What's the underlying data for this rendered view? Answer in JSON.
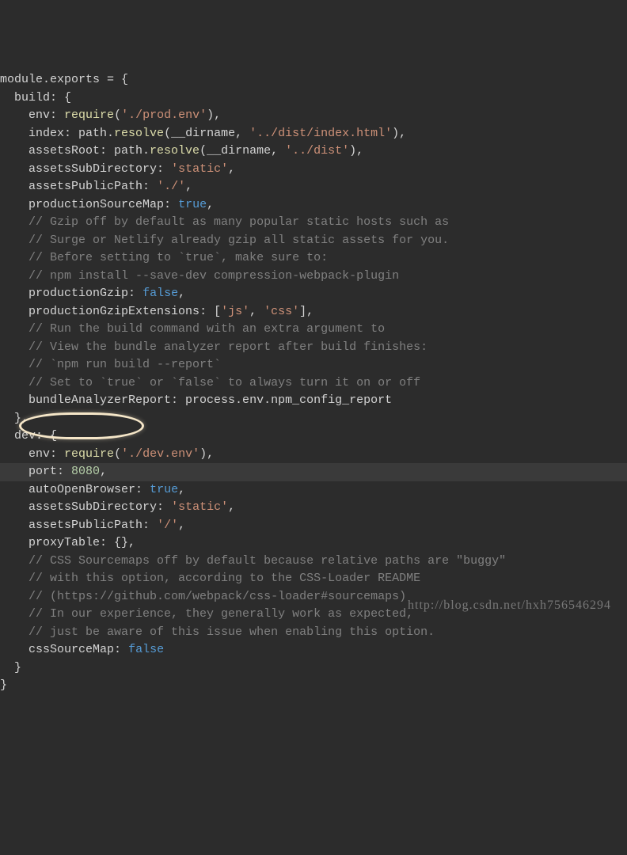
{
  "lines": [
    {
      "indent": 0,
      "seg": [
        {
          "cls": "ident",
          "t": "module"
        },
        {
          "cls": "punct",
          "t": "."
        },
        {
          "cls": "ident",
          "t": "exports"
        },
        {
          "cls": "punct",
          "t": " = {"
        }
      ]
    },
    {
      "indent": 1,
      "seg": [
        {
          "cls": "prop",
          "t": "build"
        },
        {
          "cls": "punct",
          "t": ": {"
        }
      ]
    },
    {
      "indent": 2,
      "seg": [
        {
          "cls": "prop",
          "t": "env"
        },
        {
          "cls": "punct",
          "t": ": "
        },
        {
          "cls": "fn",
          "t": "require"
        },
        {
          "cls": "punct",
          "t": "("
        },
        {
          "cls": "str",
          "t": "'./prod.env'"
        },
        {
          "cls": "punct",
          "t": "),"
        }
      ]
    },
    {
      "indent": 2,
      "seg": [
        {
          "cls": "prop",
          "t": "index"
        },
        {
          "cls": "punct",
          "t": ": path."
        },
        {
          "cls": "fn",
          "t": "resolve"
        },
        {
          "cls": "punct",
          "t": "(__dirname, "
        },
        {
          "cls": "str",
          "t": "'../dist/index.html'"
        },
        {
          "cls": "punct",
          "t": "),"
        }
      ]
    },
    {
      "indent": 2,
      "seg": [
        {
          "cls": "prop",
          "t": "assetsRoot"
        },
        {
          "cls": "punct",
          "t": ": path."
        },
        {
          "cls": "fn",
          "t": "resolve"
        },
        {
          "cls": "punct",
          "t": "(__dirname, "
        },
        {
          "cls": "str",
          "t": "'../dist'"
        },
        {
          "cls": "punct",
          "t": "),"
        }
      ]
    },
    {
      "indent": 2,
      "seg": [
        {
          "cls": "prop",
          "t": "assetsSubDirectory"
        },
        {
          "cls": "punct",
          "t": ": "
        },
        {
          "cls": "str",
          "t": "'static'"
        },
        {
          "cls": "punct",
          "t": ","
        }
      ]
    },
    {
      "indent": 2,
      "seg": [
        {
          "cls": "prop",
          "t": "assetsPublicPath"
        },
        {
          "cls": "punct",
          "t": ": "
        },
        {
          "cls": "str",
          "t": "'./'"
        },
        {
          "cls": "punct",
          "t": ","
        }
      ]
    },
    {
      "indent": 2,
      "seg": [
        {
          "cls": "prop",
          "t": "productionSourceMap"
        },
        {
          "cls": "punct",
          "t": ": "
        },
        {
          "cls": "bool",
          "t": "true"
        },
        {
          "cls": "punct",
          "t": ","
        }
      ]
    },
    {
      "indent": 2,
      "seg": [
        {
          "cls": "comment",
          "t": "// Gzip off by default as many popular static hosts such as"
        }
      ]
    },
    {
      "indent": 2,
      "seg": [
        {
          "cls": "comment",
          "t": "// Surge or Netlify already gzip all static assets for you."
        }
      ]
    },
    {
      "indent": 2,
      "seg": [
        {
          "cls": "comment",
          "t": "// Before setting to `true`, make sure to:"
        }
      ]
    },
    {
      "indent": 2,
      "seg": [
        {
          "cls": "comment",
          "t": "// npm install --save-dev compression-webpack-plugin"
        }
      ]
    },
    {
      "indent": 2,
      "seg": [
        {
          "cls": "prop",
          "t": "productionGzip"
        },
        {
          "cls": "punct",
          "t": ": "
        },
        {
          "cls": "bool",
          "t": "false"
        },
        {
          "cls": "punct",
          "t": ","
        }
      ]
    },
    {
      "indent": 2,
      "seg": [
        {
          "cls": "prop",
          "t": "productionGzipExtensions"
        },
        {
          "cls": "punct",
          "t": ": ["
        },
        {
          "cls": "str",
          "t": "'js'"
        },
        {
          "cls": "punct",
          "t": ", "
        },
        {
          "cls": "str",
          "t": "'css'"
        },
        {
          "cls": "punct",
          "t": "],"
        }
      ]
    },
    {
      "indent": 2,
      "seg": [
        {
          "cls": "comment",
          "t": "// Run the build command with an extra argument to"
        }
      ]
    },
    {
      "indent": 2,
      "seg": [
        {
          "cls": "comment",
          "t": "// View the bundle analyzer report after build finishes:"
        }
      ]
    },
    {
      "indent": 2,
      "seg": [
        {
          "cls": "comment",
          "t": "// `npm run build --report`"
        }
      ]
    },
    {
      "indent": 2,
      "seg": [
        {
          "cls": "comment",
          "t": "// Set to `true` or `false` to always turn it on or off"
        }
      ]
    },
    {
      "indent": 2,
      "seg": [
        {
          "cls": "prop",
          "t": "bundleAnalyzerReport"
        },
        {
          "cls": "punct",
          "t": ": process.env.npm_config_report"
        }
      ]
    },
    {
      "indent": 1,
      "seg": [
        {
          "cls": "punct",
          "t": "},"
        }
      ]
    },
    {
      "indent": 1,
      "seg": [
        {
          "cls": "prop",
          "t": "dev"
        },
        {
          "cls": "punct",
          "t": ": {"
        }
      ]
    },
    {
      "indent": 2,
      "seg": [
        {
          "cls": "prop",
          "t": "env"
        },
        {
          "cls": "punct",
          "t": ": "
        },
        {
          "cls": "fn",
          "t": "require"
        },
        {
          "cls": "punct",
          "t": "("
        },
        {
          "cls": "str",
          "t": "'./dev.env'"
        },
        {
          "cls": "punct",
          "t": "),"
        }
      ]
    },
    {
      "indent": 2,
      "highlight": true,
      "seg": [
        {
          "cls": "prop",
          "t": "port"
        },
        {
          "cls": "punct",
          "t": ": "
        },
        {
          "cls": "num",
          "t": "8080"
        },
        {
          "cls": "punct",
          "t": ","
        }
      ]
    },
    {
      "indent": 2,
      "seg": [
        {
          "cls": "prop",
          "t": "autoOpenBrowser"
        },
        {
          "cls": "punct",
          "t": ": "
        },
        {
          "cls": "bool",
          "t": "true"
        },
        {
          "cls": "punct",
          "t": ","
        }
      ]
    },
    {
      "indent": 2,
      "seg": [
        {
          "cls": "prop",
          "t": "assetsSubDirectory"
        },
        {
          "cls": "punct",
          "t": ": "
        },
        {
          "cls": "str",
          "t": "'static'"
        },
        {
          "cls": "punct",
          "t": ","
        }
      ]
    },
    {
      "indent": 2,
      "seg": [
        {
          "cls": "prop",
          "t": "assetsPublicPath"
        },
        {
          "cls": "punct",
          "t": ": "
        },
        {
          "cls": "str",
          "t": "'/'"
        },
        {
          "cls": "punct",
          "t": ","
        }
      ]
    },
    {
      "indent": 2,
      "seg": [
        {
          "cls": "prop",
          "t": "proxyTable"
        },
        {
          "cls": "punct",
          "t": ": {},"
        }
      ]
    },
    {
      "indent": 2,
      "seg": [
        {
          "cls": "comment",
          "t": "// CSS Sourcemaps off by default because relative paths are \"buggy\""
        }
      ]
    },
    {
      "indent": 2,
      "seg": [
        {
          "cls": "comment",
          "t": "// with this option, according to the CSS-Loader README"
        }
      ]
    },
    {
      "indent": 2,
      "seg": [
        {
          "cls": "comment",
          "t": "// (https://github.com/webpack/css-loader#sourcemaps)"
        }
      ]
    },
    {
      "indent": 2,
      "seg": [
        {
          "cls": "comment",
          "t": "// In our experience, they generally work as expected,"
        }
      ]
    },
    {
      "indent": 2,
      "seg": [
        {
          "cls": "comment",
          "t": "// just be aware of this issue when enabling this option."
        }
      ]
    },
    {
      "indent": 2,
      "seg": [
        {
          "cls": "prop",
          "t": "cssSourceMap"
        },
        {
          "cls": "punct",
          "t": ": "
        },
        {
          "cls": "bool",
          "t": "false"
        }
      ]
    },
    {
      "indent": 1,
      "seg": [
        {
          "cls": "punct",
          "t": "}"
        }
      ]
    },
    {
      "indent": 0,
      "seg": [
        {
          "cls": "punct",
          "t": "}"
        }
      ]
    }
  ],
  "watermark": "http://blog.csdn.net/hxh756546294"
}
